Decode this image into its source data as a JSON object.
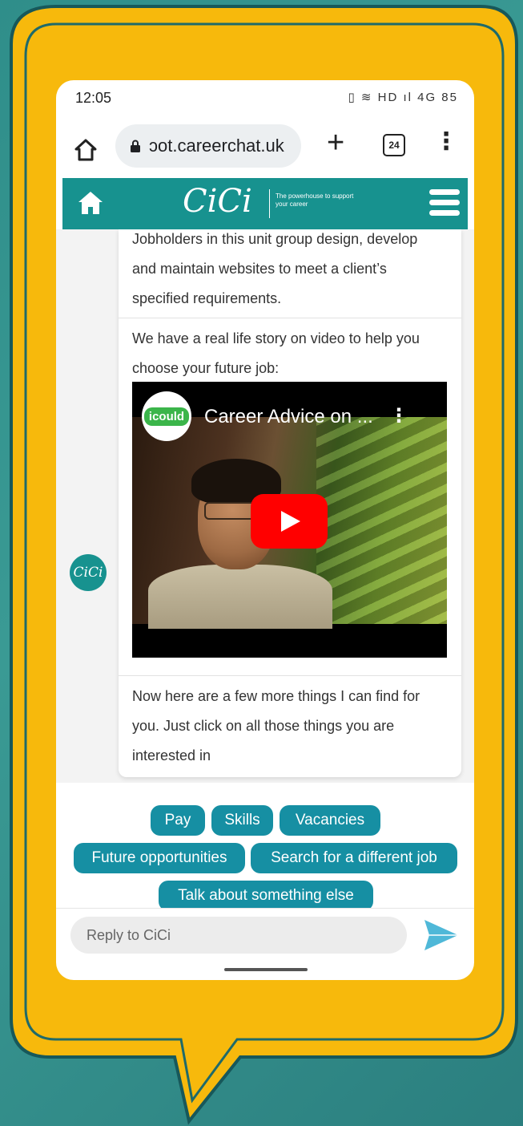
{
  "status_bar": {
    "time": "12:05",
    "icons": "▯ ≋ HD ıl 4G 85"
  },
  "browser": {
    "url": "ɔot.careerchat.uk",
    "tab_count": "24"
  },
  "app_header": {
    "logo": "CiCi",
    "tagline": "The powerhouse to support your career"
  },
  "chat": {
    "avatar": "CiCi",
    "message_1": "Jobholders in this unit group design, develop and maintain websites to meet a client’s specified requirements.",
    "message_2": "We have a real life story on video to help you choose your future job:",
    "video": {
      "channel": "icould",
      "title": "Career Advice on ..."
    },
    "message_3": "Now here are a few more things I can find for you. Just click on all those things you are interested in"
  },
  "quick_replies": [
    "Pay",
    "Skills",
    "Vacancies",
    "Future opportunities",
    "Search for a different job",
    "Talk about something else"
  ],
  "reply": {
    "placeholder": "Reply to CiCi"
  },
  "colors": {
    "brand_teal": "#17928f",
    "chip_blue": "#168fa3",
    "frame_yellow": "#f7b90c",
    "youtube_red": "#ff0000"
  }
}
